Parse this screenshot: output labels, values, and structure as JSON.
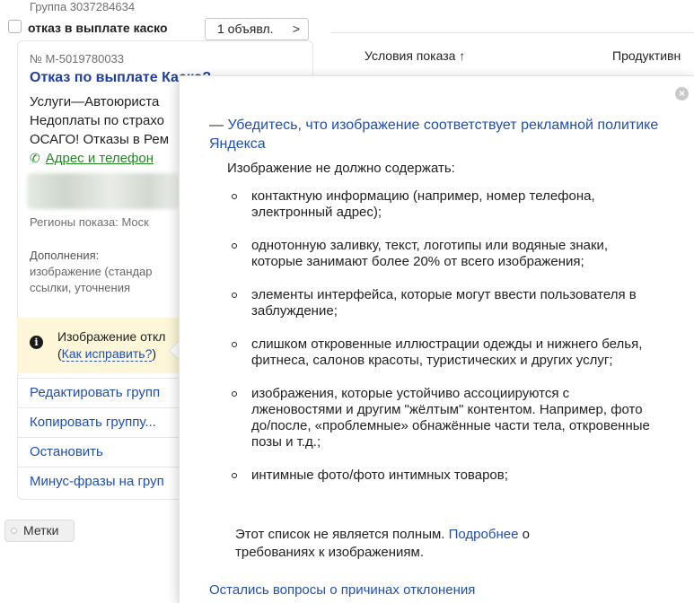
{
  "group": {
    "id_text": "Группа 3037284634",
    "name": "отказ в выплате каско",
    "ads_button": "1 объявл."
  },
  "ad": {
    "number": "№ М-5019780033",
    "title": "Отказ по выплате Каско?",
    "text_lines": [
      "Услуги—Автоюриста",
      "Недоплаты по страхо",
      "ОСАГО! Отказы в Рем"
    ],
    "contacts_label": "Адрес и телефон",
    "regions": "Регионы показа: Моск",
    "additions_label": "Дополнения:",
    "additions_lines": [
      "изображение (стандар",
      "ссылки, уточнения"
    ]
  },
  "warning": {
    "text": "Изображение откл",
    "link_prefix": "(",
    "link": "Как исправить?",
    "link_suffix": ")"
  },
  "actions": [
    {
      "label": "Редактировать групп"
    },
    {
      "label": "Копировать группу..."
    },
    {
      "label": "Остановить"
    },
    {
      "label": "Минус-фразы на груп"
    }
  ],
  "labels_button": "Метки",
  "table": {
    "col_conditions": "Условия показа ↑",
    "col_productivity": "Продуктивн"
  },
  "popup": {
    "title": "Убедитесь, что изображение соответствует рекламной политике Яндекса",
    "intro": "Изображение не должно содержать:",
    "items": [
      "контактную информацию (например, номер телефона, электронный адрес);",
      "однотонную заливку, текст, логотипы или водяные знаки, которые занимают более 20% от всего изображения;",
      "элементы интерфейса, которые могут ввести пользователя в заблуждение;",
      "слишком откровенные иллюстрации одежды и нижнего белья, фитнеса, салонов красоты, туристических и других услуг;",
      "изображения, которые устойчиво ассоциируются с лженовостями и другим \"жёлтым\" контентом. Например, фото до/после, «проблемные» обнажённые части тела, откровенные позы и т.д.;",
      "интимные фото/фото интимных товаров;"
    ],
    "note_text": "Этот список не является полным.",
    "note_link": "Подробнее",
    "note_tail": "о требованиях к изображениям.",
    "footer_link": "Остались вопросы о причинах отклонения"
  },
  "colors": {
    "link": "#1f4fb3",
    "title_link": "#1f3ea0",
    "contact_green": "#20891f",
    "warning_bg": "#fdf6d8"
  },
  "icons": [
    "close-icon",
    "info-icon",
    "phone-icon",
    "chevron-right-icon",
    "label-icon"
  ]
}
